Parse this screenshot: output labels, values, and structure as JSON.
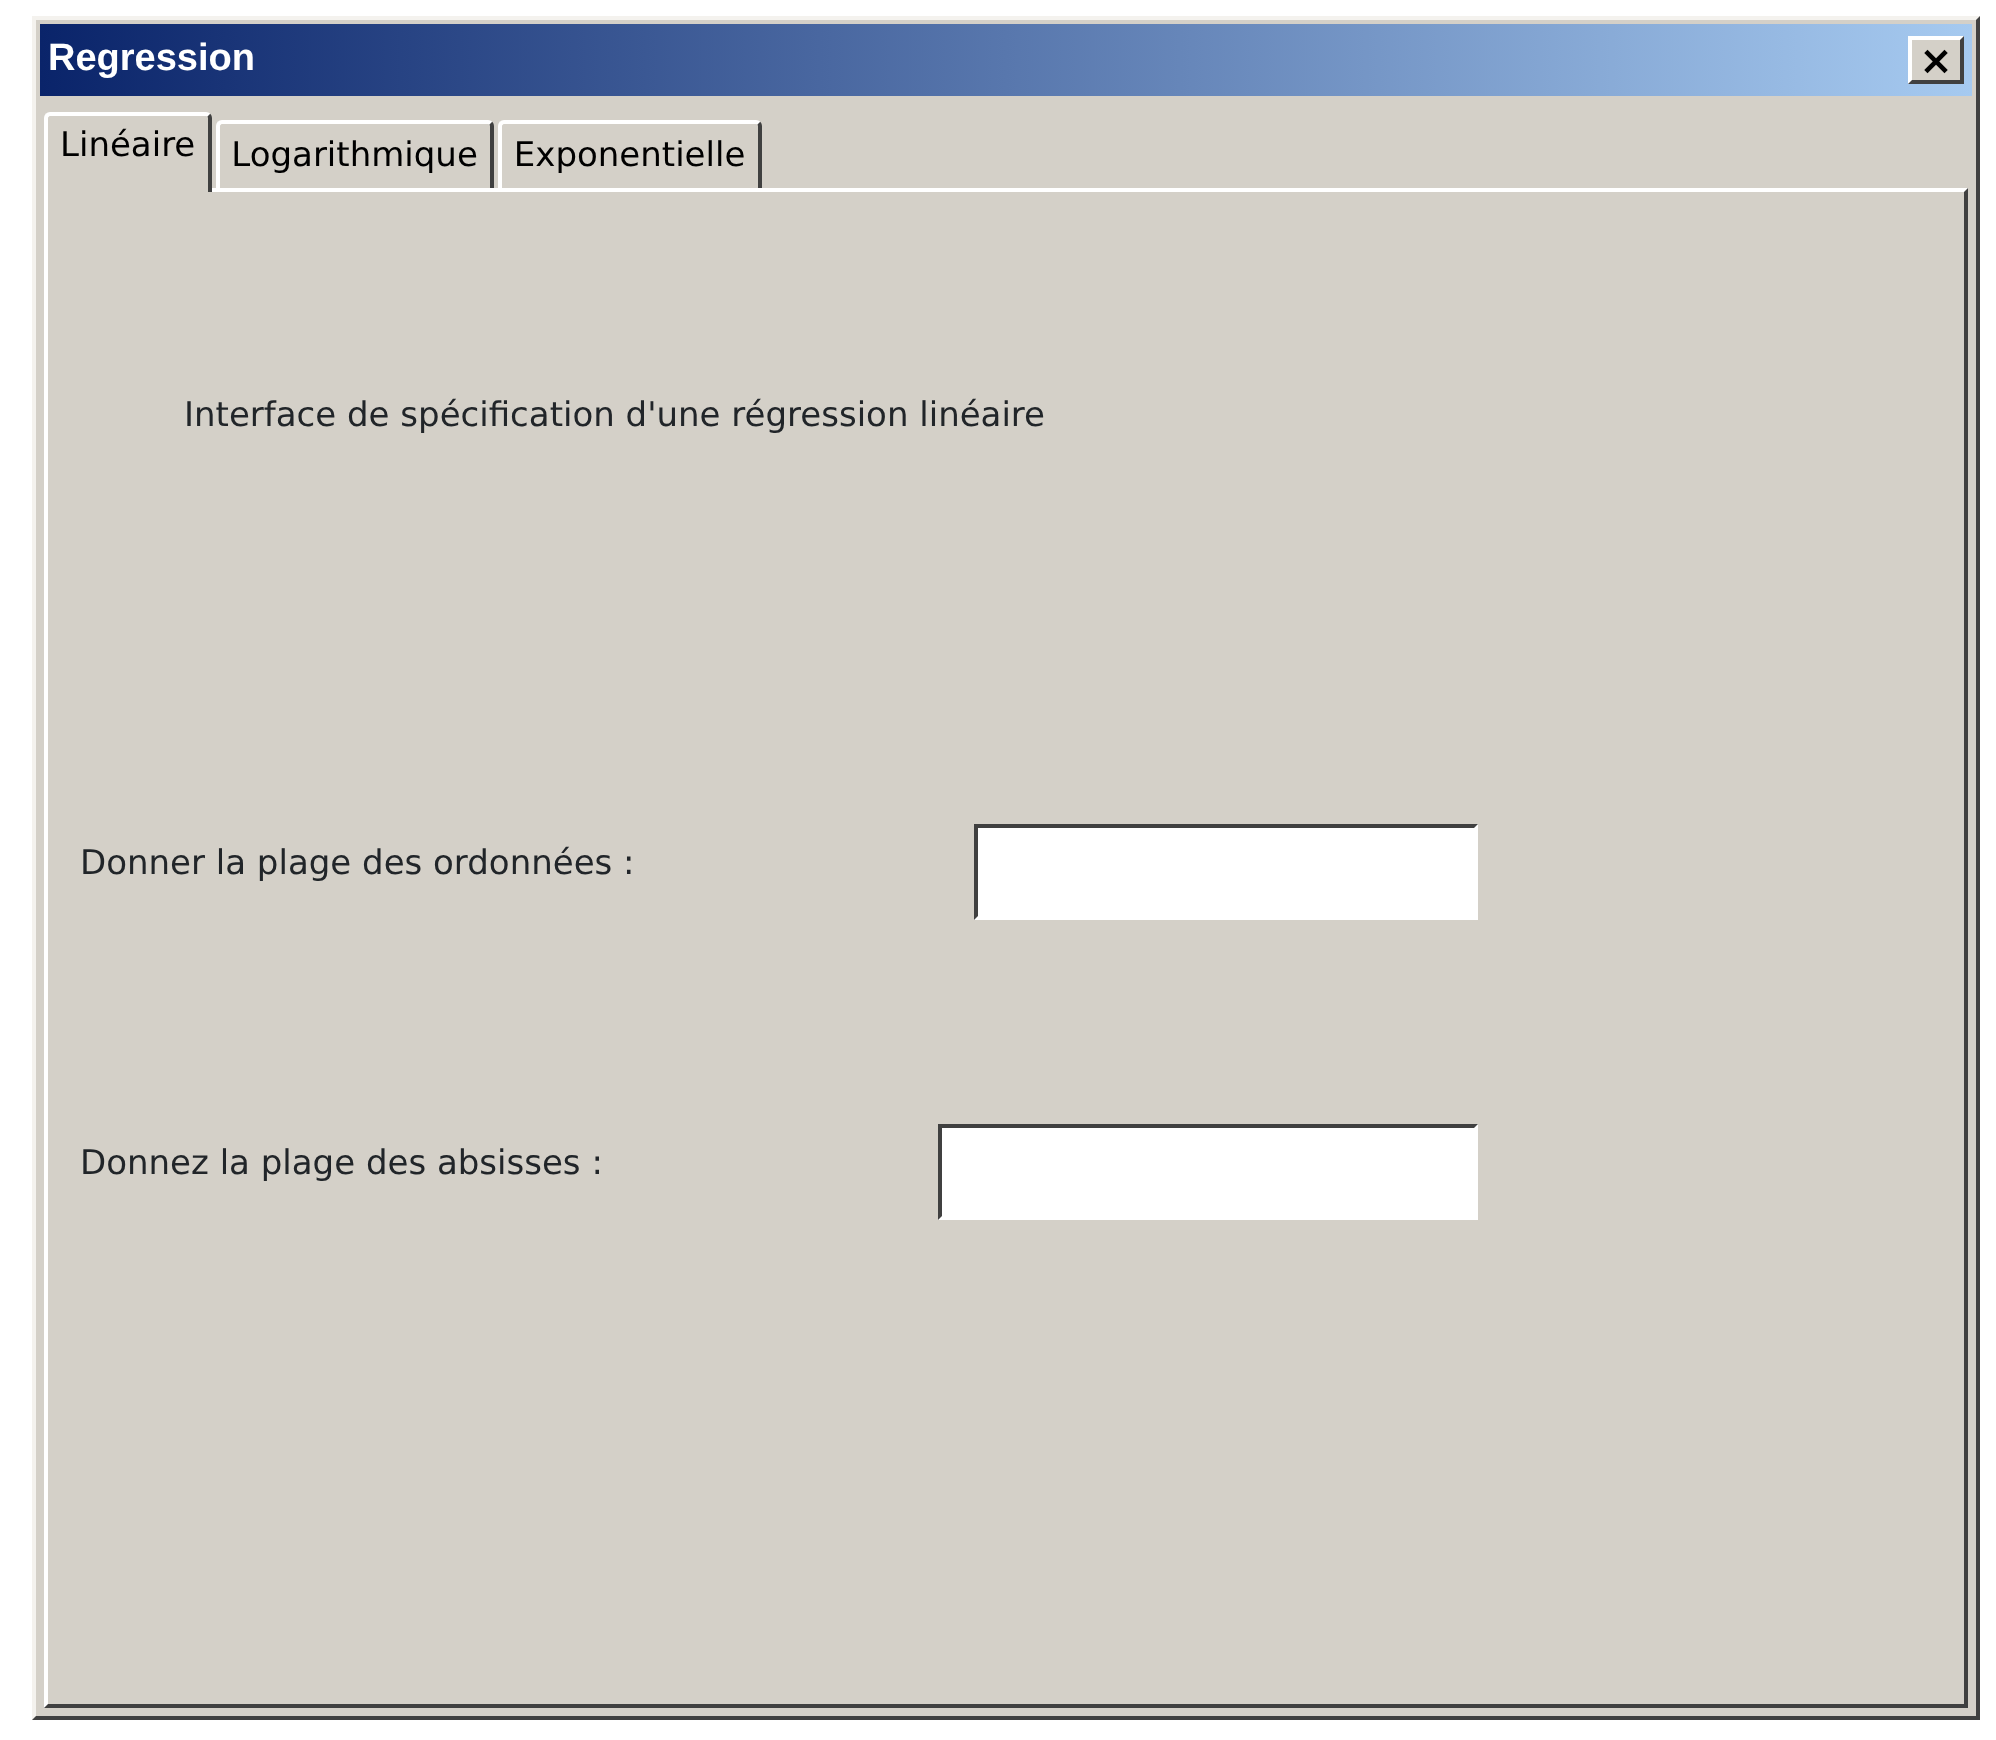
{
  "window": {
    "title": "Regression",
    "close": "×"
  },
  "tabs": [
    {
      "label": "Linéaire",
      "selected": true
    },
    {
      "label": "Logarithmique",
      "selected": false
    },
    {
      "label": "Exponentielle",
      "selected": false
    }
  ],
  "description": "Interface de spécification d'une régression linéaire",
  "fields": [
    {
      "label": "Donner la plage des ordonnées :"
    },
    {
      "label": "Donnez la plage des absisses :"
    }
  ]
}
